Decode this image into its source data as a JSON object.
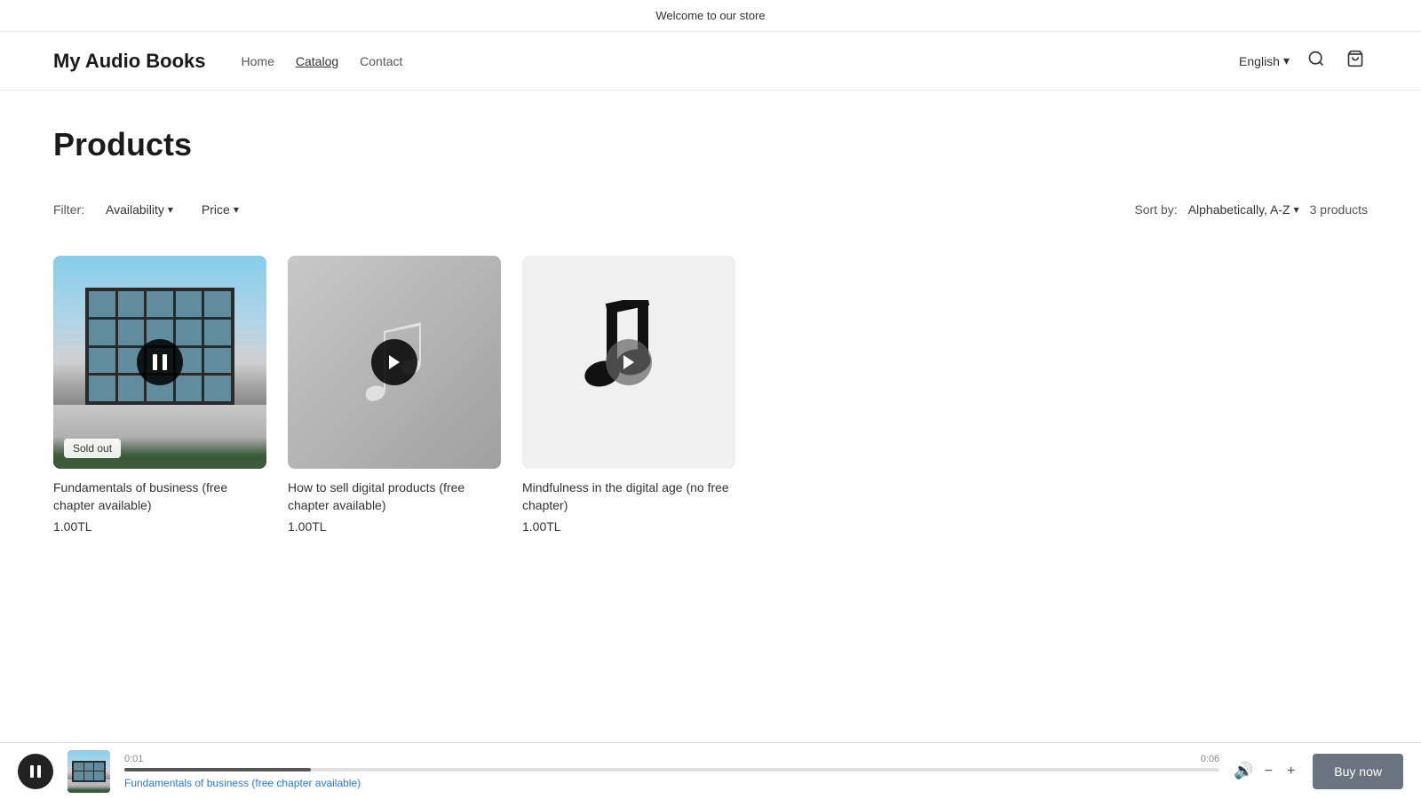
{
  "announcement": {
    "text": "Welcome to our store"
  },
  "header": {
    "store_title": "My Audio Books",
    "nav": [
      {
        "label": "Home",
        "active": false
      },
      {
        "label": "Catalog",
        "active": true
      },
      {
        "label": "Contact",
        "active": false
      }
    ],
    "language": "English",
    "search_label": "Search",
    "cart_label": "Cart"
  },
  "main": {
    "page_title": "Products",
    "filter": {
      "label": "Filter:",
      "availability_label": "Availability",
      "price_label": "Price"
    },
    "sort": {
      "label": "Sort by:",
      "value": "Alphabetically, A-Z"
    },
    "products_count": "3 products",
    "products": [
      {
        "id": 1,
        "name": "Fundamentals of business (free chapter available)",
        "price": "1.00TL",
        "sold_out": true,
        "state": "playing",
        "image_type": "building"
      },
      {
        "id": 2,
        "name": "How to sell digital products (free chapter available)",
        "price": "1.00TL",
        "sold_out": false,
        "state": "paused",
        "image_type": "music_gradient"
      },
      {
        "id": 3,
        "name": "Mindfulness in the digital age (no free chapter)",
        "price": "1.00TL",
        "sold_out": false,
        "state": "paused",
        "image_type": "music_plain"
      }
    ]
  },
  "player": {
    "track_name": "Fundamentals of business (free chapter available)",
    "current_time": "0:01",
    "total_time": "0:06",
    "progress_percent": 17,
    "buy_now_label": "Buy now",
    "volume_icon": "🔊"
  }
}
